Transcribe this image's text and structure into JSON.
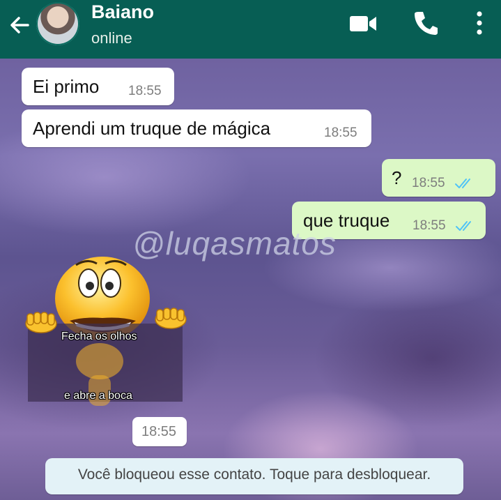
{
  "header": {
    "contact_name": "Baiano",
    "contact_status": "online",
    "color": "#075e54"
  },
  "messages": [
    {
      "direction": "incoming",
      "text": "Ei primo",
      "time": "18:55"
    },
    {
      "direction": "incoming",
      "text": "Aprendi um truque de mágica",
      "time": "18:55"
    },
    {
      "direction": "outgoing",
      "text": "?",
      "time": "18:55",
      "status": "read"
    },
    {
      "direction": "outgoing",
      "text": "que truque",
      "time": "18:55",
      "status": "read"
    }
  ],
  "sticker": {
    "icon": "grinning-emoji-holding-sign",
    "line1": "Fecha os olhos",
    "line2": "e abre a boca",
    "time": "18:55"
  },
  "watermark": "@luqasmatos",
  "system_notice": "Você bloqueou esse contato. Toque para desbloquear.",
  "colors": {
    "incoming_bubble": "#ffffff",
    "outgoing_bubble": "#dcf8c6",
    "read_ticks": "#4fc3f7",
    "notice_bg": "#e3f2f7"
  }
}
